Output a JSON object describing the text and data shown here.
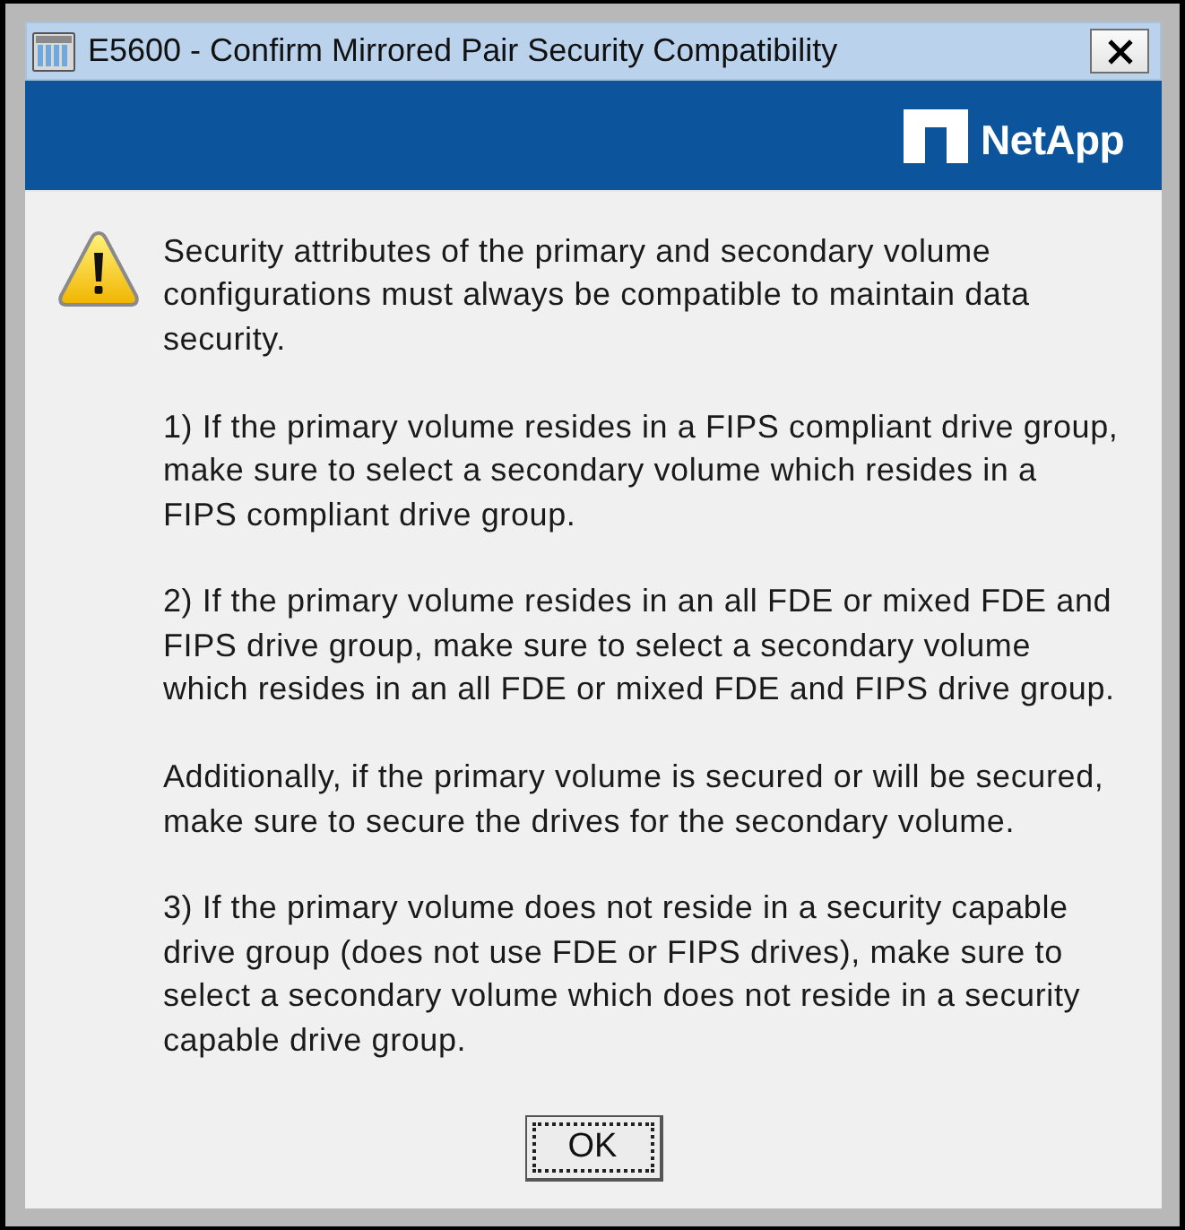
{
  "window": {
    "title": "E5600 - Confirm Mirrored Pair Security Compatibility"
  },
  "banner": {
    "logo_text": "NetApp"
  },
  "message": {
    "paragraphs": [
      {
        "lines": [
          "Security attributes of the primary and secondary volume",
          "configurations must always be compatible to maintain data",
          "security."
        ]
      },
      {
        "lines": [
          "1) If the primary volume resides in a FIPS compliant drive group,",
          "make sure to select a secondary volume which resides in a",
          "FIPS compliant drive group."
        ]
      },
      {
        "lines": [
          "2) If the primary volume resides in an all FDE or mixed FDE and",
          "FIPS drive group, make sure to select a secondary volume",
          "which resides in an all FDE or mixed FDE and FIPS drive group."
        ]
      },
      {
        "lines": [
          "Additionally, if the primary volume is secured or will be secured,",
          "make sure to secure the drives for the secondary volume."
        ]
      },
      {
        "lines": [
          "3) If the primary volume does not reside in a security capable",
          "drive group (does not use FDE or FIPS drives), make sure to",
          "select a secondary volume which does not reside in a security",
          "capable drive group."
        ]
      }
    ]
  },
  "buttons": [
    {
      "label": "OK",
      "focused": true
    }
  ]
}
